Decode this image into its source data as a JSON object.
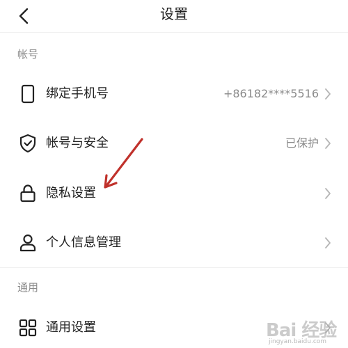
{
  "header": {
    "title": "设置",
    "back_icon": "chevron-left-icon"
  },
  "sections": [
    {
      "title": "帐号",
      "items": [
        {
          "label": "绑定手机号",
          "value": "+86182****5516",
          "icon": "phone-icon"
        },
        {
          "label": "帐号与安全",
          "value": "已保护",
          "icon": "shield-check-icon"
        },
        {
          "label": "隐私设置",
          "value": "",
          "icon": "lock-icon"
        },
        {
          "label": "个人信息管理",
          "value": "",
          "icon": "person-icon"
        }
      ]
    },
    {
      "title": "通用",
      "items": [
        {
          "label": "通用设置",
          "value": "",
          "icon": "grid-icon"
        }
      ]
    }
  ],
  "annotation": {
    "color": "#c0312b"
  },
  "watermark": {
    "brand": "Bai 经验",
    "url": "jingyan.baidu.com"
  }
}
